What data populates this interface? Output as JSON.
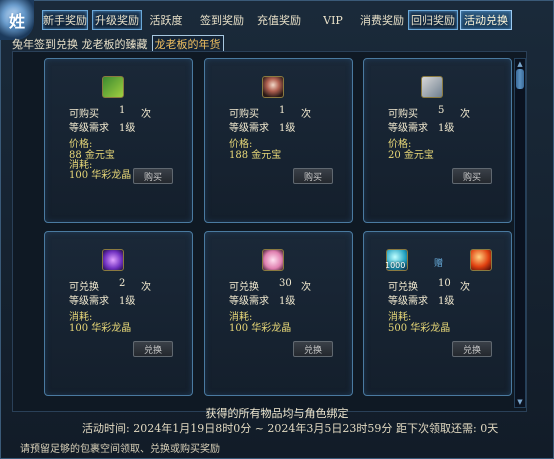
{
  "logo_char": "姓",
  "tabs": [
    {
      "label": "新手奖励",
      "boxed": true,
      "active": false
    },
    {
      "label": "升级奖励",
      "boxed": true,
      "active": false
    },
    {
      "label": "活跃度",
      "boxed": false,
      "active": false
    },
    {
      "label": "签到奖励",
      "boxed": false,
      "active": false
    },
    {
      "label": "充值奖励",
      "boxed": false,
      "active": false
    },
    {
      "label": "VIP",
      "boxed": false,
      "active": false
    },
    {
      "label": "消费奖励",
      "boxed": false,
      "active": false
    },
    {
      "label": "回归奖励",
      "boxed": true,
      "active": false
    },
    {
      "label": "活动兑换",
      "boxed": true,
      "active": true
    }
  ],
  "subtabs": {
    "text": "兔年签到兑换 龙老板的臻藏",
    "active": "龙老板的年货"
  },
  "cards": [
    {
      "icon": "chest-icon",
      "icon_class": "icon-chest",
      "count_label": "可购买",
      "count": "1",
      "unit": "次",
      "level_label": "等级需求",
      "level": "1级",
      "cost_label": "价格:",
      "cost_line1": "88 金元宝",
      "cost_line2_label": "消耗:",
      "cost_line2": "100 华彩龙晶",
      "button": "购买"
    },
    {
      "icon": "hero-portrait-icon",
      "icon_class": "icon-hero",
      "count_label": "可购买",
      "count": "1",
      "unit": "次",
      "level_label": "等级需求",
      "level": "1级",
      "cost_label": "价格:",
      "cost_line1": "188 金元宝",
      "cost_line2_label": "",
      "cost_line2": "",
      "button": "购买"
    },
    {
      "icon": "cube-icon",
      "icon_class": "icon-cube",
      "count_label": "可购买",
      "count": "5",
      "unit": "次",
      "level_label": "等级需求",
      "level": "1级",
      "cost_label": "价格:",
      "cost_line1": "20 金元宝",
      "cost_line2_label": "",
      "cost_line2": "",
      "button": "购买"
    },
    {
      "icon": "crystal-icon",
      "icon_class": "icon-crystal",
      "count_label": "可兑换",
      "count": "2",
      "unit": "次",
      "level_label": "等级需求",
      "level": "1级",
      "cost_label": "消耗:",
      "cost_line1": "100 华彩龙晶",
      "cost_line2_label": "",
      "cost_line2": "",
      "button": "兑换"
    },
    {
      "icon": "petal-icon",
      "icon_class": "icon-petal",
      "count_label": "可兑换",
      "count": "30",
      "unit": "次",
      "level_label": "等级需求",
      "level": "1级",
      "cost_label": "消耗:",
      "cost_line1": "100 华彩龙晶",
      "cost_line2_label": "",
      "cost_line2": "",
      "button": "兑换"
    },
    {
      "icon": "orb-icon",
      "icon_class": "icon-orb",
      "icon_caption": "1000",
      "gift": "赠",
      "icon2": "red-orb-icon",
      "count_label": "可兑换",
      "count": "10",
      "unit": "次",
      "level_label": "等级需求",
      "level": "1级",
      "cost_label": "消耗:",
      "cost_line1": "500 华彩龙晶",
      "cost_line2_label": "",
      "cost_line2": "",
      "button": "兑换"
    }
  ],
  "notice": "获得的所有物品均与角色绑定",
  "period_label": "活动时间:",
  "period_value": "2024年1月19日8时0分 ~ 2024年3月5日23时59分",
  "remain_label": "距下次领取还需:",
  "remain_value": "0天",
  "footer": "请预留足够的包裹空间领取、兑换或购买奖励"
}
